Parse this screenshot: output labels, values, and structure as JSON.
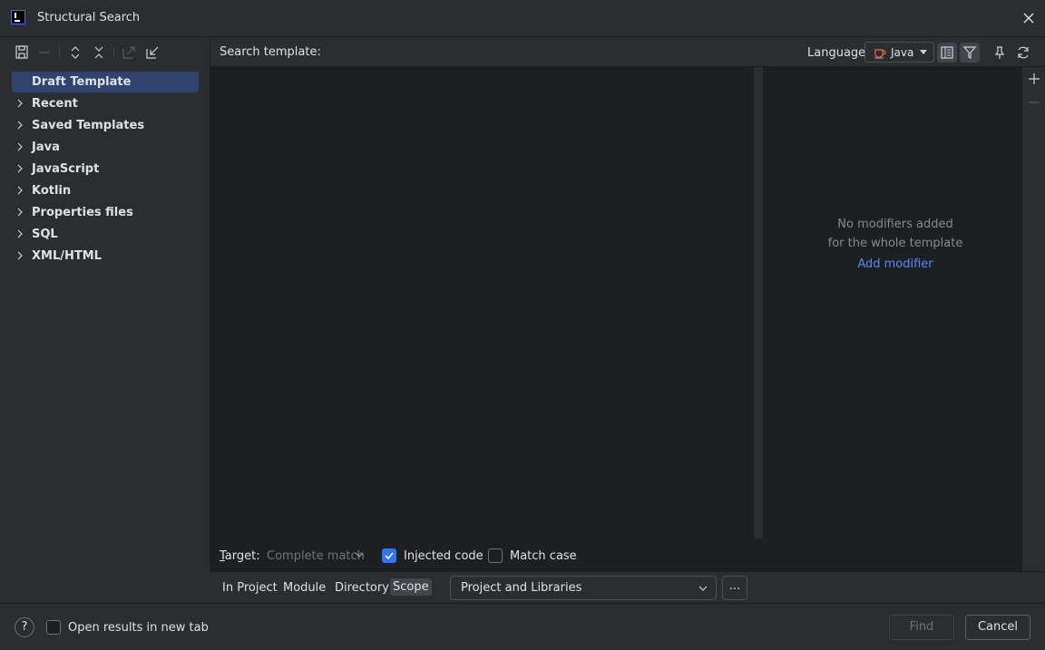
{
  "window": {
    "title": "Structural Search"
  },
  "tree": {
    "items": [
      {
        "label": "Draft Template",
        "selected": true,
        "expandable": false
      },
      {
        "label": "Recent",
        "expandable": true
      },
      {
        "label": "Saved Templates",
        "expandable": true
      },
      {
        "label": "Java",
        "expandable": true
      },
      {
        "label": "JavaScript",
        "expandable": true
      },
      {
        "label": "Kotlin",
        "expandable": true
      },
      {
        "label": "Properties files",
        "expandable": true
      },
      {
        "label": "SQL",
        "expandable": true
      },
      {
        "label": "XML/HTML",
        "expandable": true
      }
    ]
  },
  "header": {
    "search_template_label": "Search template:",
    "language_label": "Language:",
    "language_value": "Java"
  },
  "modifiers": {
    "empty_line1": "No modifiers added",
    "empty_line2": "for the whole template",
    "add_link": "Add modifier"
  },
  "options": {
    "target_label": "Target:",
    "target_value": "Complete match",
    "injected_code_label": "Injected code",
    "injected_code_checked": true,
    "match_case_label": "Match case",
    "match_case_checked": false
  },
  "scope": {
    "tabs": [
      "In Project",
      "Module",
      "Directory",
      "Scope"
    ],
    "active_tab": "Scope",
    "combo_value": "Project and Libraries",
    "more_button": "..."
  },
  "footer": {
    "help_label": "?",
    "open_new_tab_label": "Open results in new tab",
    "open_new_tab_checked": false,
    "find_label": "Find",
    "cancel_label": "Cancel"
  },
  "colors": {
    "background": "#2b2d30",
    "editor_bg": "#1e1f22",
    "selection": "#2e436e",
    "accent": "#3574f0",
    "link": "#548af7"
  }
}
